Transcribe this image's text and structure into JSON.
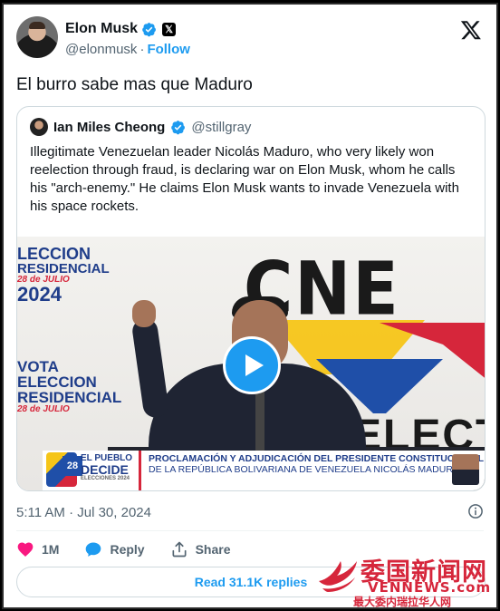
{
  "author": {
    "name": "Elon Musk",
    "handle": "@elonmusk",
    "follow_label": "Follow"
  },
  "tweet": {
    "text": "El burro sabe mas que Maduro",
    "timestamp": "5:11 AM · Jul 30, 2024"
  },
  "quoted": {
    "name": "Ian Miles Cheong",
    "handle": "@stillgray",
    "text": "Illegitimate Venezuelan leader Nicolás Maduro, who very likely won reelection through fraud, is declaring war on Elon Musk, whom he calls his \"arch-enemy.\" He claims Elon Musk wants to invade Venezuela with his space rockets."
  },
  "video": {
    "wall_logo": "CNE",
    "wall_text": "ELECT",
    "left_logo": {
      "line1": "LECCION",
      "line2": "RESIDENCIAL",
      "line3": "28 de JULIO",
      "line4": "2024"
    },
    "left_logo_2": {
      "line1": "VOTA",
      "line2": "ELECCION",
      "line3": "RESIDENCIAL",
      "line4": "28 de JULIO"
    },
    "lower_third": {
      "brand_number": "28",
      "brand_line1": "EL PUEBLO",
      "brand_line2": "DECIDE",
      "brand_line3": "ELECCIONES 2024",
      "headline": "PROCLAMACIÓN Y ADJUDICACIÓN DEL PRESIDENTE CONSTITUCIONAL",
      "subline": "DE LA REPÚBLICA BOLIVARIANA DE VENEZUELA NICOLÁS MADURO"
    }
  },
  "actions": {
    "like_count": "1M",
    "reply_label": "Reply",
    "share_label": "Share"
  },
  "read_replies_label": "Read 31.1K replies",
  "watermark": {
    "chinese": "委国新闻网",
    "english": "VENNEWS.com",
    "sub": "最大委内瑞拉华人网"
  },
  "colors": {
    "accent": "#1d9bf0",
    "like": "#f91880",
    "text": "#0f1419",
    "muted": "#536471",
    "watermark": "#d6263b"
  },
  "icons": [
    "verified-badge-icon",
    "x-affiliate-icon",
    "x-logo-icon",
    "play-icon",
    "info-icon",
    "heart-icon",
    "reply-bubble-icon",
    "share-icon"
  ]
}
